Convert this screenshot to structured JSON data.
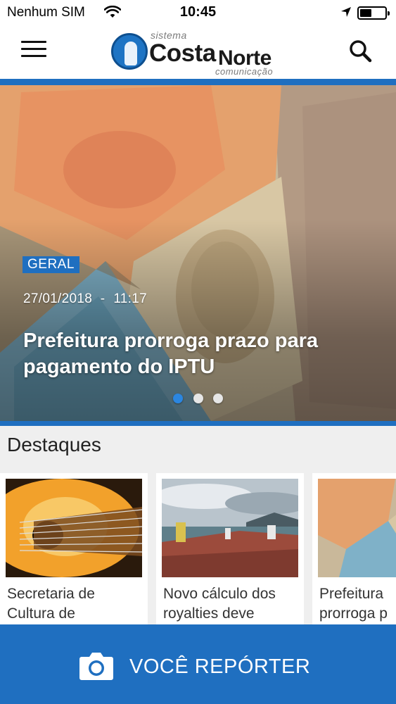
{
  "status_bar": {
    "carrier": "Nenhum SIM",
    "time": "10:45"
  },
  "header": {
    "logo": {
      "line1": "sistema",
      "brand1": "Costa",
      "brand2": "Norte",
      "line3": "comunicação"
    },
    "menu_icon": "hamburger-menu-icon",
    "search_icon": "search-icon"
  },
  "hero": {
    "category": "GERAL",
    "date": "27/01/2018",
    "separator": "-",
    "time": "11:17",
    "title": "Prefeitura prorroga prazo para pagamento do IPTU",
    "slides_total": 3,
    "active_slide": 1
  },
  "destaques": {
    "title": "Destaques",
    "cards": [
      {
        "caption": "Secretaria de\nCultura de"
      },
      {
        "caption": "Novo cálculo dos\nroyalties deve"
      },
      {
        "caption": "Prefeitura\nprorroga p"
      }
    ]
  },
  "reporter": {
    "label": "VOCÊ REPÓRTER",
    "icon": "camera-icon"
  },
  "colors": {
    "accent": "#1f6fc0",
    "dot_active": "#2b86e0"
  }
}
